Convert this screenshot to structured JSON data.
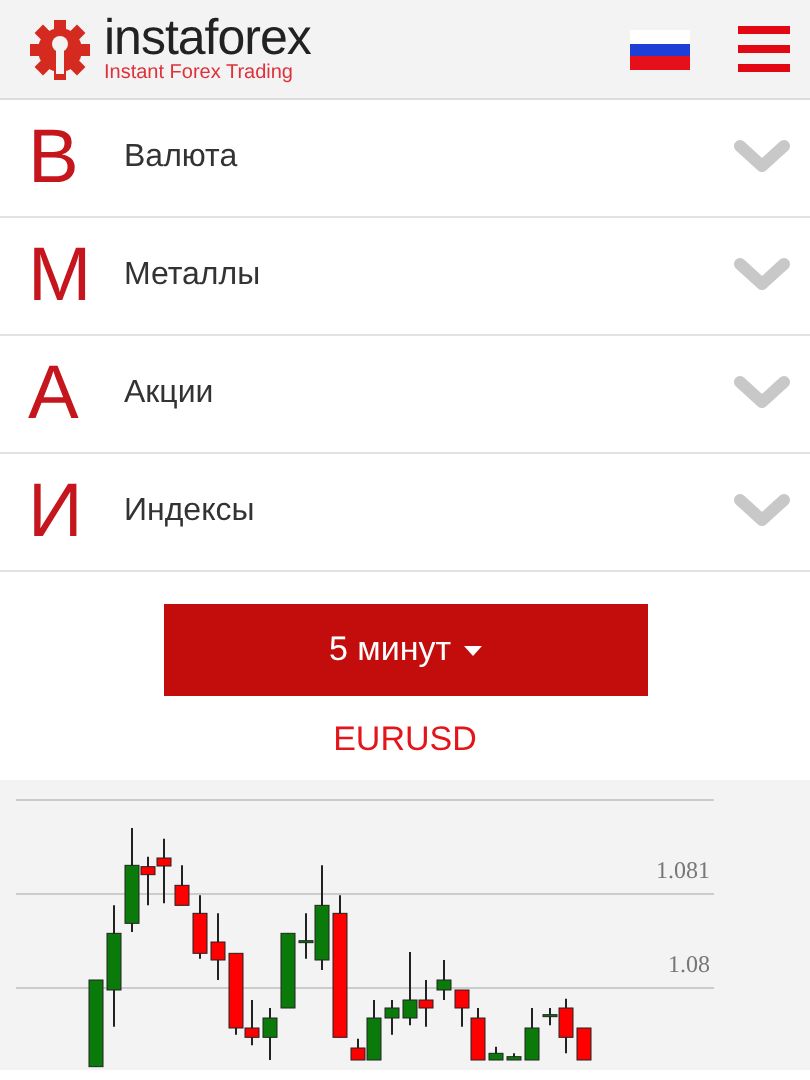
{
  "header": {
    "logo_name": "instaforex",
    "tagline": "Instant Forex Trading"
  },
  "categories": [
    {
      "letter": "В",
      "label": "Валюта",
      "expanded": false
    },
    {
      "letter": "М",
      "label": "Металлы",
      "expanded": false
    },
    {
      "letter": "А",
      "label": "Акции",
      "expanded": false
    },
    {
      "letter": "И",
      "label": "Индексы",
      "expanded": false
    }
  ],
  "timeframe_button": {
    "label": "5 минут"
  },
  "symbol": "EURUSD",
  "chart": {
    "price_labels": [
      "1.081",
      "1.08"
    ]
  }
}
